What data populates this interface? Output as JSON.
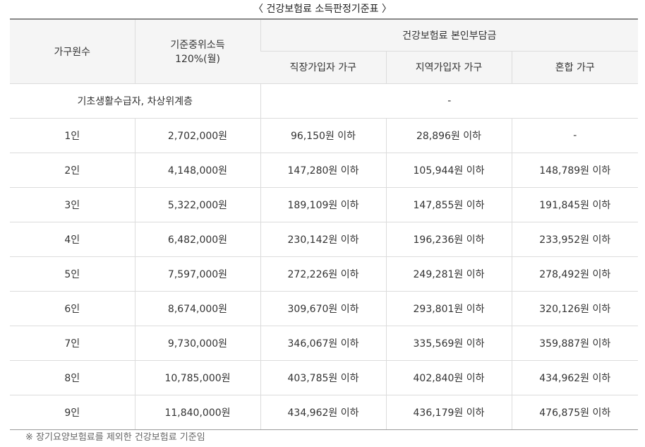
{
  "caption": "〈 건강보험료 소득판정기준표 〉",
  "header": {
    "household_size": "가구원수",
    "median_income_line1": "기준중위소득",
    "median_income_line2": "120%(월)",
    "premium_group": "건강보험료 본인부담금",
    "employee": "직장가입자 가구",
    "regional": "지역가입자 가구",
    "mixed": "혼합 가구"
  },
  "special_row": {
    "label": "기초생활수급자, 차상위계층",
    "value": "-"
  },
  "rows": [
    {
      "size": "1인",
      "income": "2,702,000원",
      "employee": "96,150원 이하",
      "regional": "28,896원 이하",
      "mixed": "-"
    },
    {
      "size": "2인",
      "income": "4,148,000원",
      "employee": "147,280원 이하",
      "regional": "105,944원 이하",
      "mixed": "148,789원 이하"
    },
    {
      "size": "3인",
      "income": "5,322,000원",
      "employee": "189,109원 이하",
      "regional": "147,855원 이하",
      "mixed": "191,845원 이하"
    },
    {
      "size": "4인",
      "income": "6,482,000원",
      "employee": "230,142원 이하",
      "regional": "196,236원 이하",
      "mixed": "233,952원 이하"
    },
    {
      "size": "5인",
      "income": "7,597,000원",
      "employee": "272,226원 이하",
      "regional": "249,281원 이하",
      "mixed": "278,492원 이하"
    },
    {
      "size": "6인",
      "income": "8,674,000원",
      "employee": "309,670원 이하",
      "regional": "293,801원 이하",
      "mixed": "320,126원 이하"
    },
    {
      "size": "7인",
      "income": "9,730,000원",
      "employee": "346,067원 이하",
      "regional": "335,569원 이하",
      "mixed": "359,887원 이하"
    },
    {
      "size": "8인",
      "income": "10,785,000원",
      "employee": "403,785원 이하",
      "regional": "402,840원 이하",
      "mixed": "434,962원 이하"
    },
    {
      "size": "9인",
      "income": "11,840,000원",
      "employee": "434,962원 이하",
      "regional": "436,179원 이하",
      "mixed": "476,875원 이하"
    }
  ],
  "footnote": "※ 장기요양보험료를 제외한 건강보험료 기준임"
}
